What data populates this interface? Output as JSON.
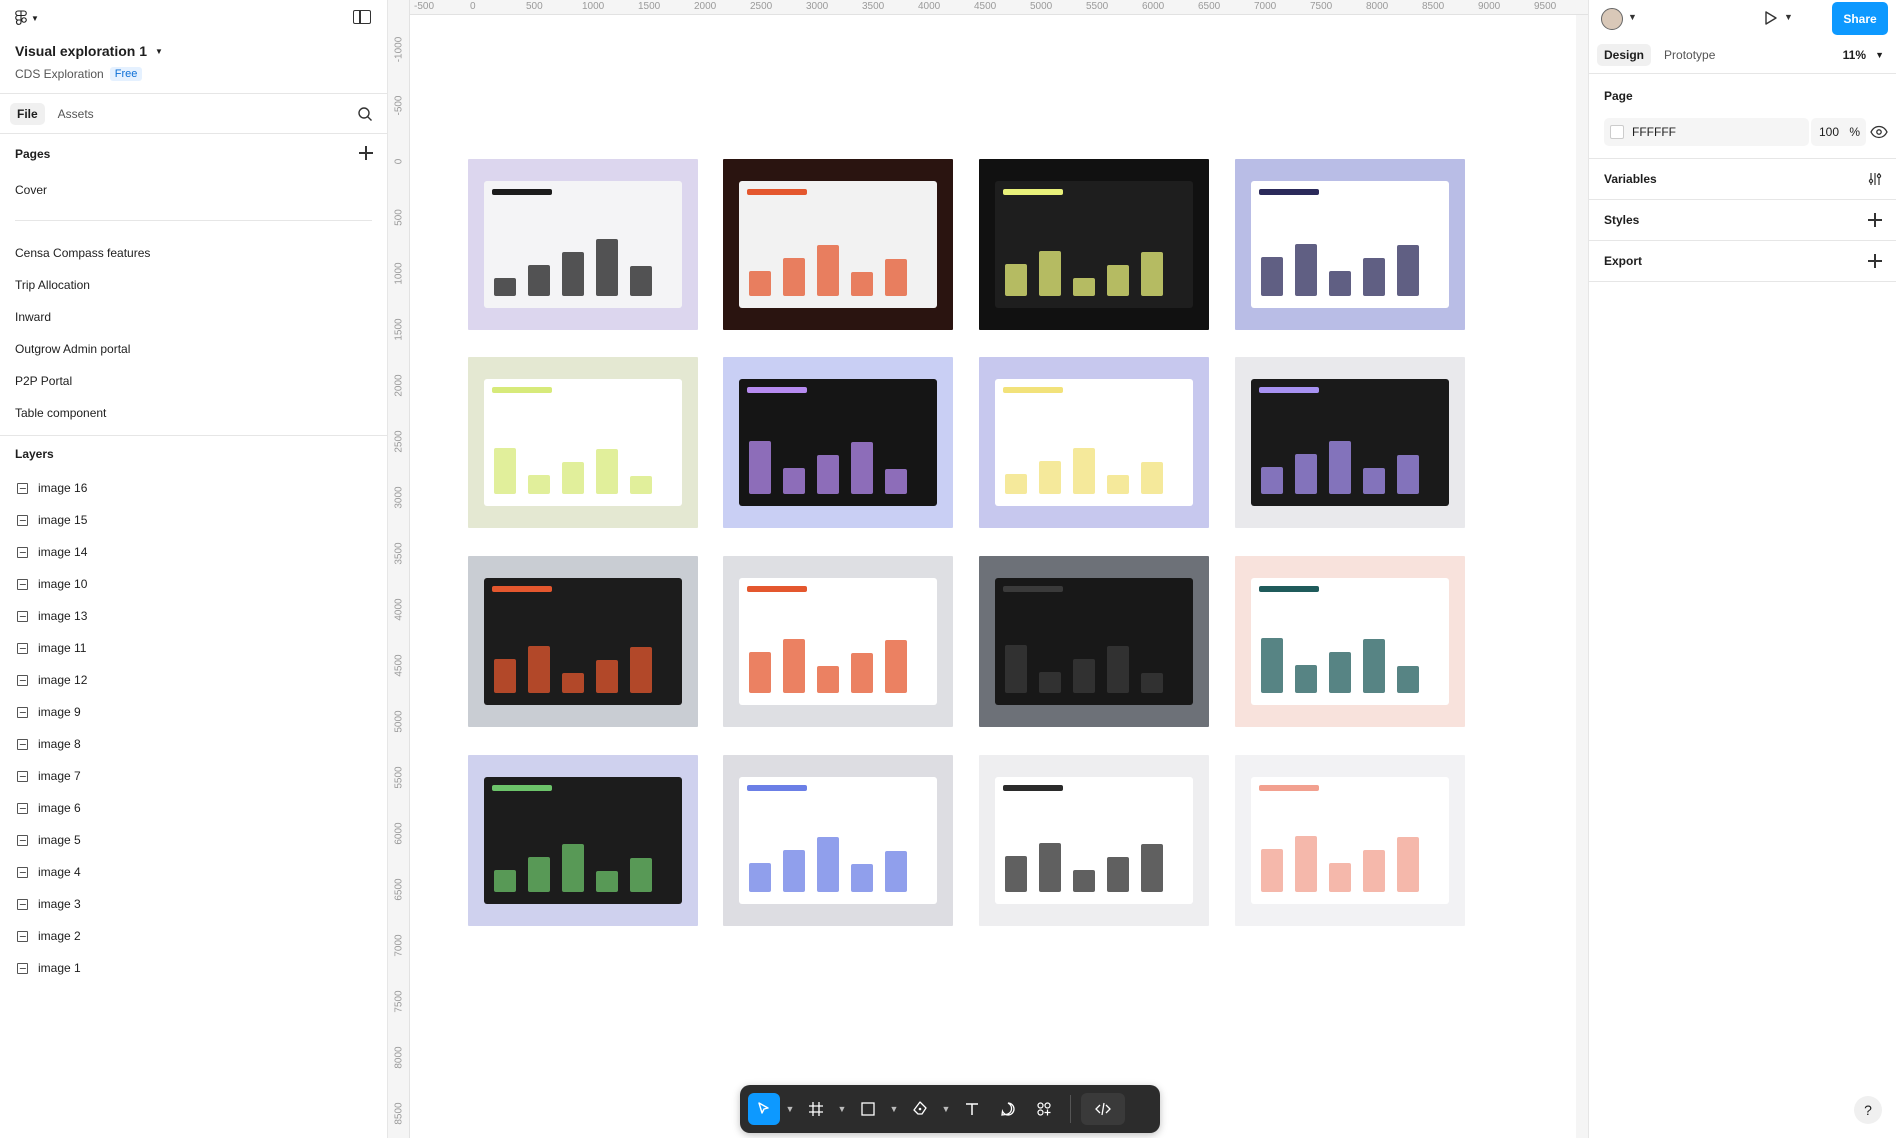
{
  "header": {
    "file_name": "Visual exploration 1",
    "project_name": "CDS Exploration",
    "plan_badge": "Free"
  },
  "left_tabs": [
    "File",
    "Assets"
  ],
  "pages": {
    "title": "Pages",
    "items": [
      "Cover",
      "Censa Compass features",
      "Trip Allocation",
      "Inward",
      "Outgrow Admin portal",
      "P2P Portal",
      "Table component"
    ]
  },
  "layers": {
    "title": "Layers",
    "items": [
      "image 16",
      "image 15",
      "image 14",
      "image 10",
      "image 13",
      "image 11",
      "image 12",
      "image 9",
      "image 8",
      "image 7",
      "image 6",
      "image 5",
      "image 4",
      "image 3",
      "image 2",
      "image 1"
    ]
  },
  "ruler": {
    "top": [
      "-500",
      "0",
      "500",
      "1000",
      "1500",
      "2000",
      "2500",
      "3000",
      "3500",
      "4000",
      "4500",
      "5000",
      "5500",
      "6000",
      "6500",
      "7000",
      "7500",
      "8000",
      "8500",
      "9000",
      "9500"
    ],
    "left": [
      "-1000",
      "-500",
      "0",
      "500",
      "1000",
      "1500",
      "2000",
      "2500",
      "3000",
      "3500",
      "4000",
      "4500",
      "5000",
      "5500",
      "6000",
      "6500",
      "7000",
      "7500",
      "8000",
      "8500"
    ]
  },
  "thumbnails": [
    {
      "bg": "#dcd6ee",
      "screen": "#f4f4f6",
      "accent": "#1c1c1c"
    },
    {
      "bg": "#2a1410",
      "screen": "#f2f2f2",
      "accent": "#e4572e"
    },
    {
      "bg": "#111111",
      "screen": "#1e1e1e",
      "accent": "#e8f07a"
    },
    {
      "bg": "#b9bde6",
      "screen": "#ffffff",
      "accent": "#2b2a5a"
    },
    {
      "bg": "#e4e8d2",
      "screen": "#ffffff",
      "accent": "#d7ea7a"
    },
    {
      "bg": "#c9cff4",
      "screen": "#151515",
      "accent": "#b68bf0"
    },
    {
      "bg": "#c7c8ee",
      "screen": "#ffffff",
      "accent": "#f2e27a"
    },
    {
      "bg": "#e9e9ec",
      "screen": "#1a1a1a",
      "accent": "#a792f2"
    },
    {
      "bg": "#c9cdd3",
      "screen": "#1c1c1c",
      "accent": "#e4572e"
    },
    {
      "bg": "#dedfe3",
      "screen": "#ffffff",
      "accent": "#e4572e"
    },
    {
      "bg": "#6d7178",
      "screen": "#181818",
      "accent": "#3a3a3a"
    },
    {
      "bg": "#f8e2dc",
      "screen": "#ffffff",
      "accent": "#1f5b5b"
    },
    {
      "bg": "#cfd1ee",
      "screen": "#1c1c1c",
      "accent": "#6cc36a"
    },
    {
      "bg": "#dddde2",
      "screen": "#ffffff",
      "accent": "#6b7fe6"
    },
    {
      "bg": "#eeeef0",
      "screen": "#ffffff",
      "accent": "#2b2b2b"
    },
    {
      "bg": "#f2f2f4",
      "screen": "#ffffff",
      "accent": "#f2a08f"
    }
  ],
  "toolbar": {
    "tools": [
      "move-tool",
      "frame-tool",
      "shape-tool",
      "pen-tool",
      "text-tool",
      "comment-tool",
      "actions-tool",
      "dev-mode-toggle"
    ]
  },
  "right_panel": {
    "share_label": "Share",
    "tabs": [
      "Design",
      "Prototype"
    ],
    "zoom": "11%",
    "page_section": "Page",
    "page_color": "FFFFFF",
    "page_opacity": "100",
    "opacity_unit": "%",
    "variables_label": "Variables",
    "styles_label": "Styles",
    "export_label": "Export"
  },
  "help_label": "?"
}
